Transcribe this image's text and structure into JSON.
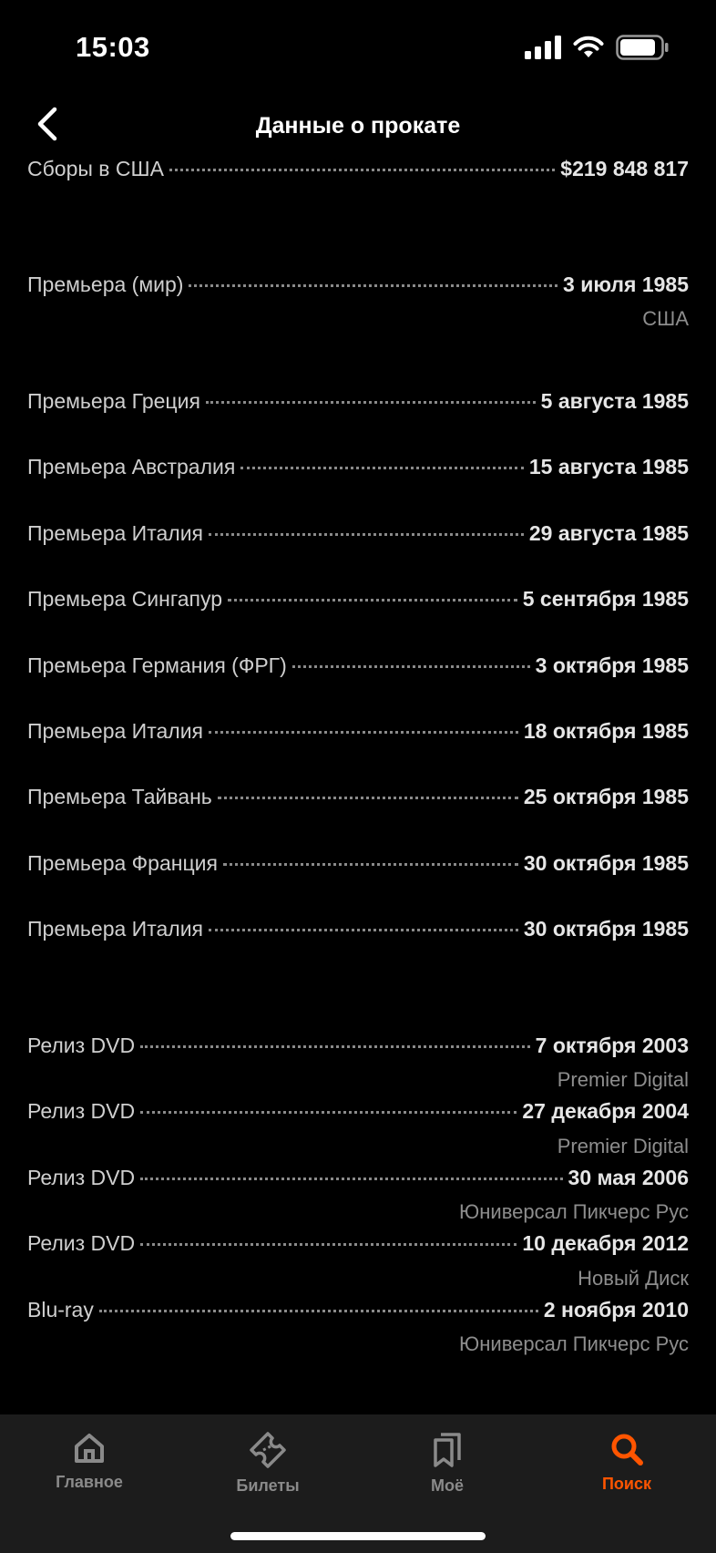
{
  "status": {
    "time": "15:03"
  },
  "header": {
    "title": "Данные о прокате"
  },
  "rows": [
    {
      "label": "Сборы в США",
      "value": "$219 848 817"
    },
    {
      "label": "Премьера (мир)",
      "value": "3 июля 1985",
      "sub": "США"
    },
    {
      "label": "Премьера Греция",
      "value": "5 августа 1985"
    },
    {
      "label": "Премьера Австралия",
      "value": "15 августа 1985"
    },
    {
      "label": "Премьера Италия",
      "value": "29 августа 1985"
    },
    {
      "label": "Премьера Сингапур",
      "value": "5 сентября 1985"
    },
    {
      "label": "Премьера Германия (ФРГ)",
      "value": "3 октября 1985"
    },
    {
      "label": "Премьера Италия",
      "value": "18 октября 1985"
    },
    {
      "label": "Премьера Тайвань",
      "value": "25 октября 1985"
    },
    {
      "label": "Премьера Франция",
      "value": "30 октября 1985"
    },
    {
      "label": "Премьера Италия",
      "value": "30 октября 1985"
    },
    {
      "label": "Релиз DVD",
      "value": "7 октября 2003",
      "sub": "Premier Digital"
    },
    {
      "label": "Релиз DVD",
      "value": "27 декабря 2004",
      "sub": "Premier Digital"
    },
    {
      "label": "Релиз DVD",
      "value": "30 мая 2006",
      "sub": "Юниверсал Пикчерс Рус"
    },
    {
      "label": "Релиз DVD",
      "value": "10 декабря 2012",
      "sub": "Новый Диск"
    },
    {
      "label": "Blu-ray",
      "value": "2 ноября 2010",
      "sub": "Юниверсал Пикчерс Рус"
    }
  ],
  "tabs": [
    {
      "label": "Главное",
      "icon": "home-icon",
      "active": false
    },
    {
      "label": "Билеты",
      "icon": "ticket-icon",
      "active": false
    },
    {
      "label": "Моё",
      "icon": "bookmarks-icon",
      "active": false
    },
    {
      "label": "Поиск",
      "icon": "search-icon",
      "active": true
    }
  ],
  "colors": {
    "accent": "#ff5500",
    "background": "#000000",
    "tabbar": "#1c1c1c"
  }
}
